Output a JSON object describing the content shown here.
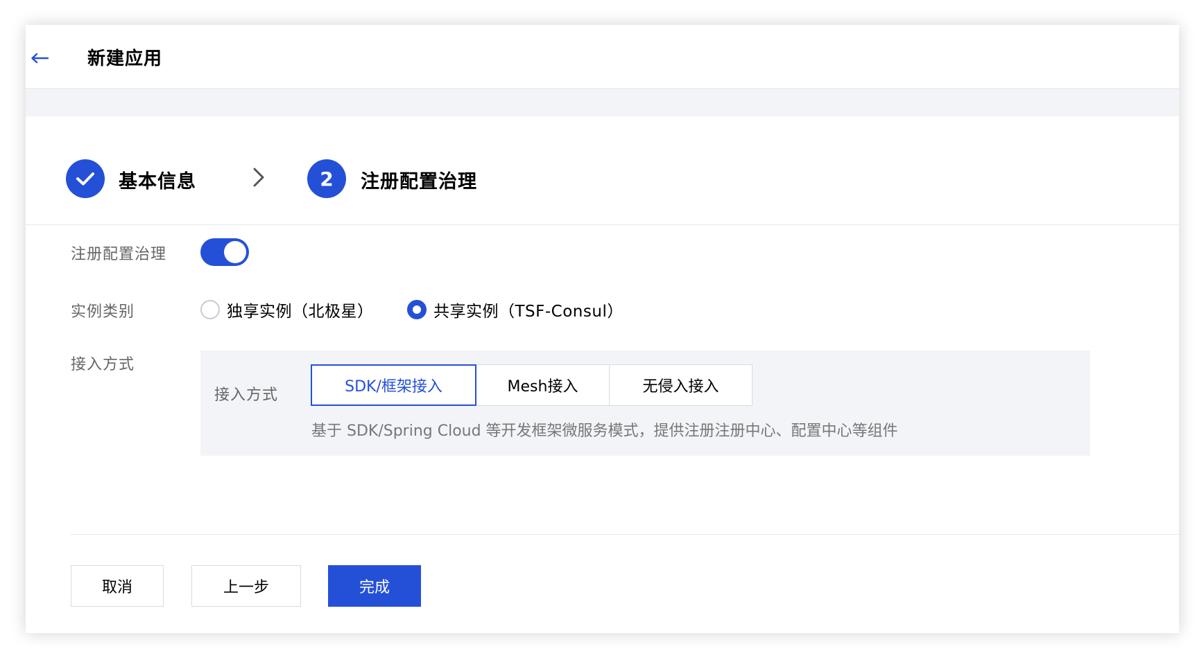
{
  "header": {
    "back_icon": "arrow-left-icon",
    "title": "新建应用"
  },
  "steps": [
    {
      "label": "基本信息",
      "status": "done",
      "icon": "check-icon"
    },
    {
      "label": "注册配置治理",
      "status": "active",
      "number": "2"
    }
  ],
  "step_separator_icon": "chevron-right-icon",
  "form": {
    "registry": {
      "label": "注册配置治理",
      "enabled": true
    },
    "instance_type": {
      "label": "实例类别",
      "options": [
        {
          "label": "独享实例（北极星）",
          "selected": false
        },
        {
          "label": "共享实例（TSF-Consul）",
          "selected": true
        }
      ]
    },
    "access": {
      "label": "接入方式",
      "panel_label": "接入方式",
      "options": [
        {
          "label": "SDK/框架接入",
          "selected": true
        },
        {
          "label": "Mesh接入",
          "selected": false
        },
        {
          "label": "无侵入接入",
          "selected": false
        }
      ],
      "description": "基于 SDK/Spring Cloud 等开发框架微服务模式，提供注册注册中心、配置中心等组件"
    }
  },
  "footer": {
    "cancel_label": "取消",
    "prev_label": "上一步",
    "finish_label": "完成"
  },
  "colors": {
    "primary": "#2450d8",
    "panel_bg": "#f2f4f8",
    "label_gray": "#666666"
  }
}
